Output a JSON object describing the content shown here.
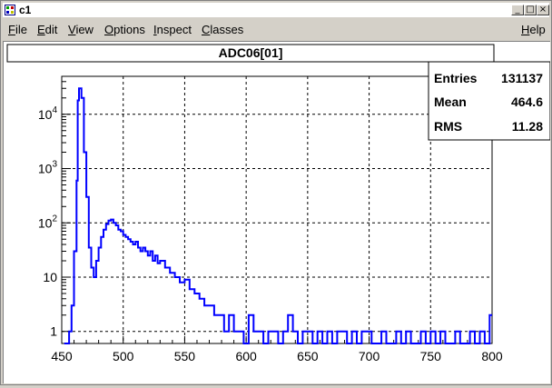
{
  "window": {
    "title": "c1",
    "colors": {
      "titlebar_bg": "#ffffff",
      "chrome": "#d4d0c8",
      "histogram": "#0000ff"
    }
  },
  "menu": {
    "items": [
      {
        "label": "File",
        "accel": "F"
      },
      {
        "label": "Edit",
        "accel": "E"
      },
      {
        "label": "View",
        "accel": "V"
      },
      {
        "label": "Options",
        "accel": "O"
      },
      {
        "label": "Inspect",
        "accel": "I"
      },
      {
        "label": "Classes",
        "accel": "C"
      }
    ],
    "help": {
      "label": "Help",
      "accel": "H"
    }
  },
  "histogram_title": "ADC06[01]",
  "stats": {
    "rows": [
      {
        "label": "Entries",
        "value": "131137"
      },
      {
        "label": "Mean",
        "value": "464.6"
      },
      {
        "label": "RMS",
        "value": "11.28"
      }
    ]
  },
  "chart_data": {
    "type": "line",
    "title": "ADC06[01]",
    "xlabel": "",
    "ylabel": "",
    "xlim": [
      450,
      800
    ],
    "ylim": [
      0.6,
      50000
    ],
    "yscale": "log",
    "grid": true,
    "x_ticks": [
      450,
      500,
      550,
      600,
      650,
      700,
      750,
      800
    ],
    "y_ticks": [
      {
        "value": 1,
        "label": "1"
      },
      {
        "value": 10,
        "label": "10"
      },
      {
        "value": 100,
        "label": "10^2"
      },
      {
        "value": 1000,
        "label": "10^3"
      },
      {
        "value": 10000,
        "label": "10^4"
      }
    ],
    "series": [
      {
        "x": [
          452,
          454,
          456,
          458,
          460,
          462,
          463,
          464,
          466,
          468,
          470,
          472,
          474,
          476,
          478,
          480,
          482,
          484,
          486,
          488,
          490,
          492,
          494,
          496,
          498,
          500,
          502,
          504,
          506,
          508,
          510,
          512,
          514,
          516,
          518,
          520,
          522,
          524,
          526,
          528,
          530,
          534,
          538,
          542,
          546,
          550,
          554,
          558,
          562,
          566,
          570,
          574,
          578,
          582,
          586,
          590,
          594,
          598,
          602,
          606,
          610,
          614,
          618,
          622,
          626,
          630,
          634,
          638,
          642,
          646,
          650,
          654,
          658,
          662,
          666,
          670,
          674,
          678,
          682,
          686,
          690,
          694,
          698,
          702,
          706,
          710,
          714,
          718,
          722,
          726,
          730,
          734,
          738,
          742,
          746,
          750,
          754,
          758,
          762,
          766,
          770,
          774,
          778,
          782,
          786,
          790,
          794,
          798
        ],
        "y": [
          0.6,
          0.6,
          1,
          3,
          30,
          600,
          18000,
          30000,
          20000,
          2000,
          300,
          35,
          15,
          10,
          20,
          35,
          55,
          75,
          95,
          110,
          115,
          100,
          90,
          75,
          70,
          60,
          55,
          50,
          45,
          40,
          45,
          35,
          30,
          35,
          30,
          25,
          30,
          20,
          25,
          18,
          20,
          15,
          12,
          10,
          8,
          9,
          6,
          5,
          4,
          3,
          3,
          2,
          2,
          1,
          2,
          1,
          1,
          0.6,
          2,
          1,
          1,
          0.6,
          1,
          1,
          0.6,
          1,
          2,
          1,
          0.6,
          1,
          1,
          0.6,
          1,
          0.6,
          1,
          0.6,
          1,
          1,
          0.6,
          1,
          0.6,
          1,
          1,
          0.6,
          0.6,
          1,
          0.6,
          0.6,
          1,
          0.6,
          1,
          0.6,
          0.6,
          1,
          0.6,
          1,
          0.6,
          1,
          0.6,
          0.6,
          1,
          0.6,
          0.6,
          1,
          0.6,
          1,
          0.6,
          2
        ]
      }
    ]
  }
}
